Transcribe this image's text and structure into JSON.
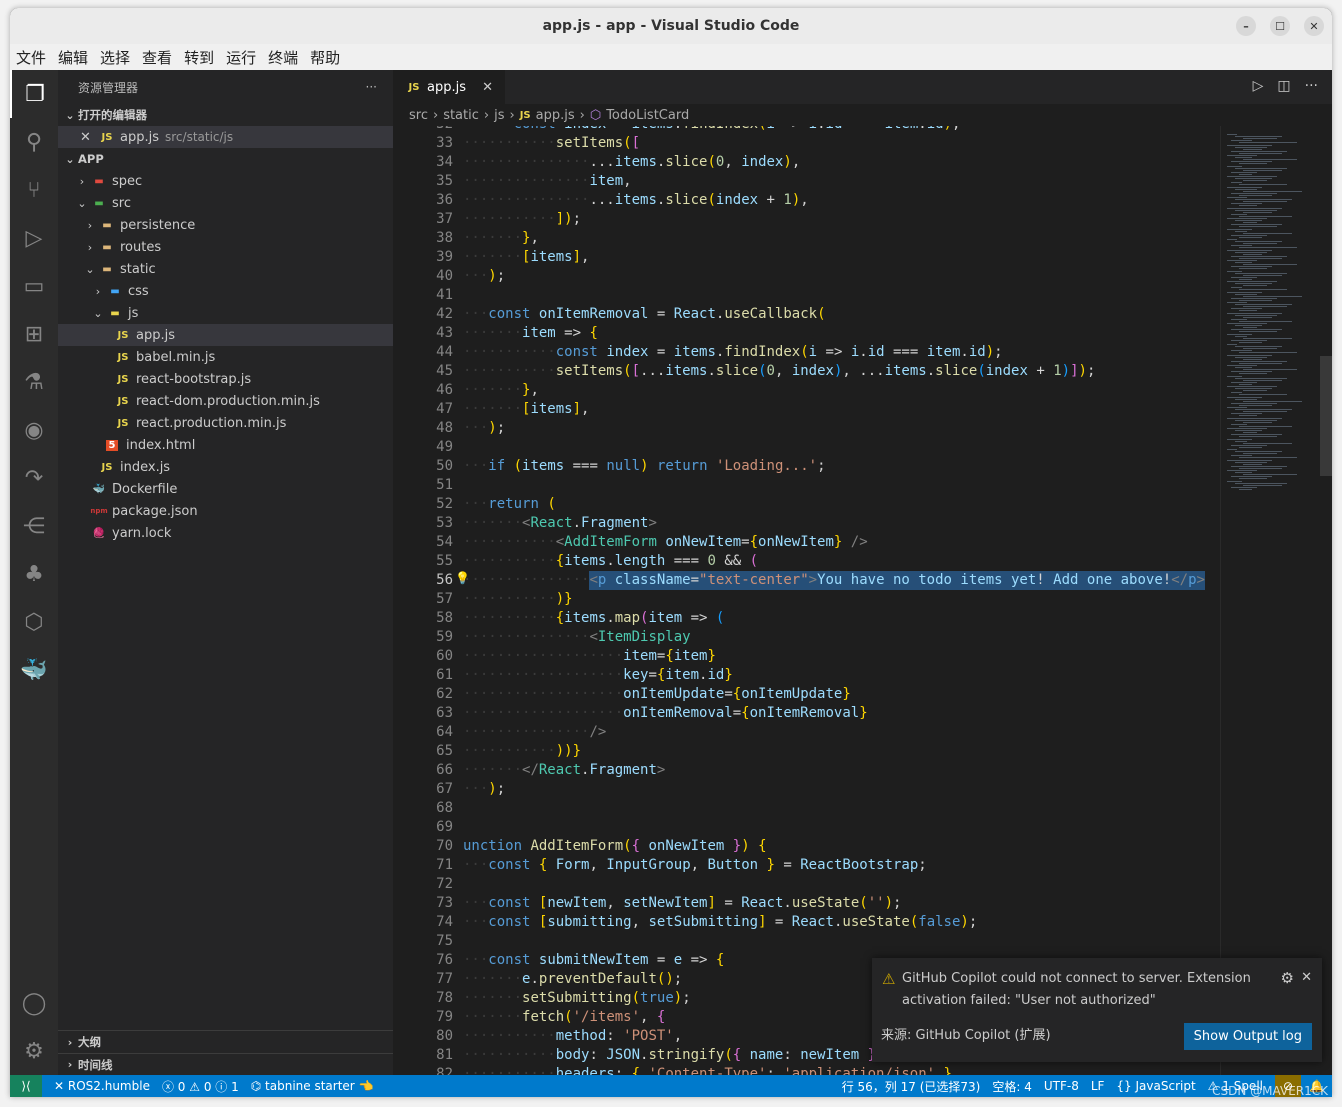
{
  "window": {
    "title": "app.js - app - Visual Studio Code"
  },
  "menu": [
    "文件",
    "编辑",
    "选择",
    "查看",
    "转到",
    "运行",
    "终端",
    "帮助"
  ],
  "sidebar": {
    "title": "资源管理器",
    "open_editors": "打开的编辑器",
    "open_file": "app.js",
    "open_file_path": "src/static/js",
    "root": "APP",
    "tree": [
      {
        "label": "spec",
        "depth": 1,
        "type": "folder",
        "open": false,
        "icon": "folder-red"
      },
      {
        "label": "src",
        "depth": 1,
        "type": "folder",
        "open": true,
        "icon": "folder-green"
      },
      {
        "label": "persistence",
        "depth": 2,
        "type": "folder",
        "open": false,
        "icon": "folder"
      },
      {
        "label": "routes",
        "depth": 2,
        "type": "folder",
        "open": false,
        "icon": "folder"
      },
      {
        "label": "static",
        "depth": 2,
        "type": "folder",
        "open": true,
        "icon": "folder"
      },
      {
        "label": "css",
        "depth": 3,
        "type": "folder",
        "open": false,
        "icon": "folder-blue"
      },
      {
        "label": "js",
        "depth": 3,
        "type": "folder",
        "open": true,
        "icon": "folder-js"
      },
      {
        "label": "app.js",
        "depth": 4,
        "type": "js",
        "selected": true
      },
      {
        "label": "babel.min.js",
        "depth": 4,
        "type": "js"
      },
      {
        "label": "react-bootstrap.js",
        "depth": 4,
        "type": "js"
      },
      {
        "label": "react-dom.production.min.js",
        "depth": 4,
        "type": "js"
      },
      {
        "label": "react.production.min.js",
        "depth": 4,
        "type": "js"
      },
      {
        "label": "index.html",
        "depth": 3,
        "type": "html"
      },
      {
        "label": "index.js",
        "depth": 2,
        "type": "js"
      },
      {
        "label": "Dockerfile",
        "depth": 1,
        "type": "docker"
      },
      {
        "label": "package.json",
        "depth": 1,
        "type": "json"
      },
      {
        "label": "yarn.lock",
        "depth": 1,
        "type": "yarn"
      }
    ],
    "outline": "大纲",
    "timeline": "时间线"
  },
  "editor": {
    "tab": "app.js",
    "breadcrumbs": [
      "src",
      "static",
      "js",
      "app.js",
      "TodoListCard"
    ],
    "current_line": 56,
    "first_line": 32,
    "lines": [
      "      const index = items.findIndex(i => i.id === item.id);",
      "           setItems([",
      "               ...items.slice(0, index),",
      "               item,",
      "               ...items.slice(index + 1),",
      "           ]);",
      "       },",
      "       [items],",
      "   );",
      "",
      "   const onItemRemoval = React.useCallback(",
      "       item => {",
      "           const index = items.findIndex(i => i.id === item.id);",
      "           setItems([...items.slice(0, index), ...items.slice(index + 1)]);",
      "       },",
      "       [items],",
      "   );",
      "",
      "   if (items === null) return 'Loading...';",
      "",
      "   return (",
      "       <React.Fragment>",
      "           <AddItemForm onNewItem={onNewItem} />",
      "           {items.length === 0 && (",
      "               <p className=\"text-center\">You have no todo items yet! Add one above!</p>",
      "           )}",
      "           {items.map(item => (",
      "               <ItemDisplay",
      "                   item={item}",
      "                   key={item.id}",
      "                   onItemUpdate={onItemUpdate}",
      "                   onItemRemoval={onItemRemoval}",
      "               />",
      "           ))}",
      "       </React.Fragment>",
      "   );",
      "",
      "",
      "unction AddItemForm({ onNewItem }) {",
      "   const { Form, InputGroup, Button } = ReactBootstrap;",
      "",
      "   const [newItem, setNewItem] = React.useState('');",
      "   const [submitting, setSubmitting] = React.useState(false);",
      "",
      "   const submitNewItem = e => {",
      "       e.preventDefault();",
      "       setSubmitting(true);",
      "       fetch('/items', {",
      "           method: 'POST',",
      "           body: JSON.stringify({ name: newItem }),",
      "           headers: { 'Content-Type': 'application/json' },"
    ]
  },
  "notification": {
    "message_line1": "GitHub Copilot could not connect to server. Extension",
    "message_line2": "activation failed: \"User not authorized\"",
    "source": "来源: GitHub Copilot (扩展)",
    "button": "Show Output log",
    "icon": "warning-icon"
  },
  "status": {
    "remote": "ROS2.humble",
    "errors": "0",
    "warnings": "0",
    "info": "1",
    "tabnine": "tabnine starter 👈",
    "position": "行 56，列 17 (已选择73)",
    "spaces": "空格: 4",
    "encoding": "UTF-8",
    "eol": "LF",
    "language": "JavaScript",
    "spell": "1 Spell",
    "watermark": "CSDN @MAVER1CK"
  },
  "colors": {
    "statusbar": "#007acc",
    "remote": "#16825d",
    "selection": "#264f78",
    "button": "#0e639c"
  }
}
